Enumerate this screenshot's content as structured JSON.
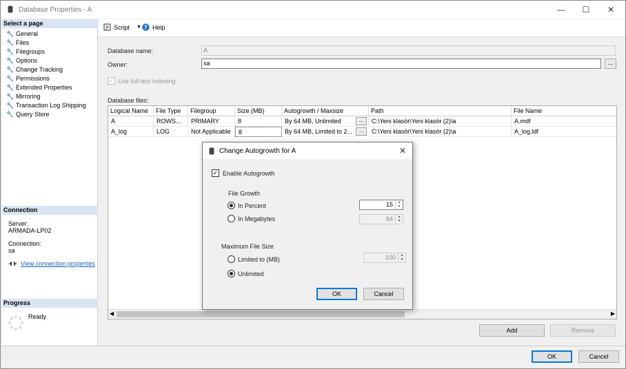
{
  "window": {
    "title": "Database Properties - A"
  },
  "left_panel": {
    "select_page_header": "Select a page",
    "items": [
      {
        "label": "General"
      },
      {
        "label": "Files"
      },
      {
        "label": "Filegroups"
      },
      {
        "label": "Options"
      },
      {
        "label": "Change Tracking"
      },
      {
        "label": "Permissions"
      },
      {
        "label": "Extended Properties"
      },
      {
        "label": "Mirroring"
      },
      {
        "label": "Transaction Log Shipping"
      },
      {
        "label": "Query Store"
      }
    ],
    "connection_header": "Connection",
    "server_label": "Server:",
    "server_value": "ARMADA-LP02",
    "connection_label": "Connection:",
    "connection_value": "sa",
    "view_connection_link": "View connection properties",
    "progress_header": "Progress",
    "progress_status": "Ready"
  },
  "toolbar": {
    "script_label": "Script",
    "help_label": "Help"
  },
  "form": {
    "database_name_label": "Database name:",
    "database_name_value": "A",
    "owner_label": "Owner:",
    "owner_value": "sa",
    "fulltext_label": "Use full-text indexing",
    "database_files_label": "Database files:"
  },
  "files_table": {
    "columns": [
      "Logical Name",
      "File Type",
      "Filegroup",
      "Size (MB)",
      "Autogrowth / Maxsize",
      "Path",
      "File Name"
    ],
    "rows": [
      [
        "A",
        "ROWS...",
        "PRIMARY",
        "8",
        "By 64 MB, Unlimited",
        "C:\\Yeni klasör\\Yeni klasör (2)\\a",
        "A.mdf"
      ],
      [
        "A_log",
        "LOG",
        "Not Applicable",
        "8",
        "By 64 MB, Limited to 2...",
        "C:\\Yeni klasör\\Yeni klasör (2)\\a",
        "A_log.ldf"
      ]
    ],
    "ellipsis": "..."
  },
  "buttons": {
    "add": "Add",
    "remove": "Remove",
    "ok": "OK",
    "cancel": "Cancel"
  },
  "dialog": {
    "title": "Change Autogrowth for A",
    "enable_autogrowth_label": "Enable Autogrowth",
    "file_growth_label": "File Growth",
    "in_percent_label": "In Percent",
    "in_percent_value": "15",
    "in_megabytes_label": "In Megabytes",
    "in_megabytes_value": "64",
    "max_file_size_label": "Maximum File Size",
    "limited_label": "Limited to (MB)",
    "limited_value": "100",
    "unlimited_label": "Unlimited",
    "ok": "OK",
    "cancel": "Cancel"
  }
}
